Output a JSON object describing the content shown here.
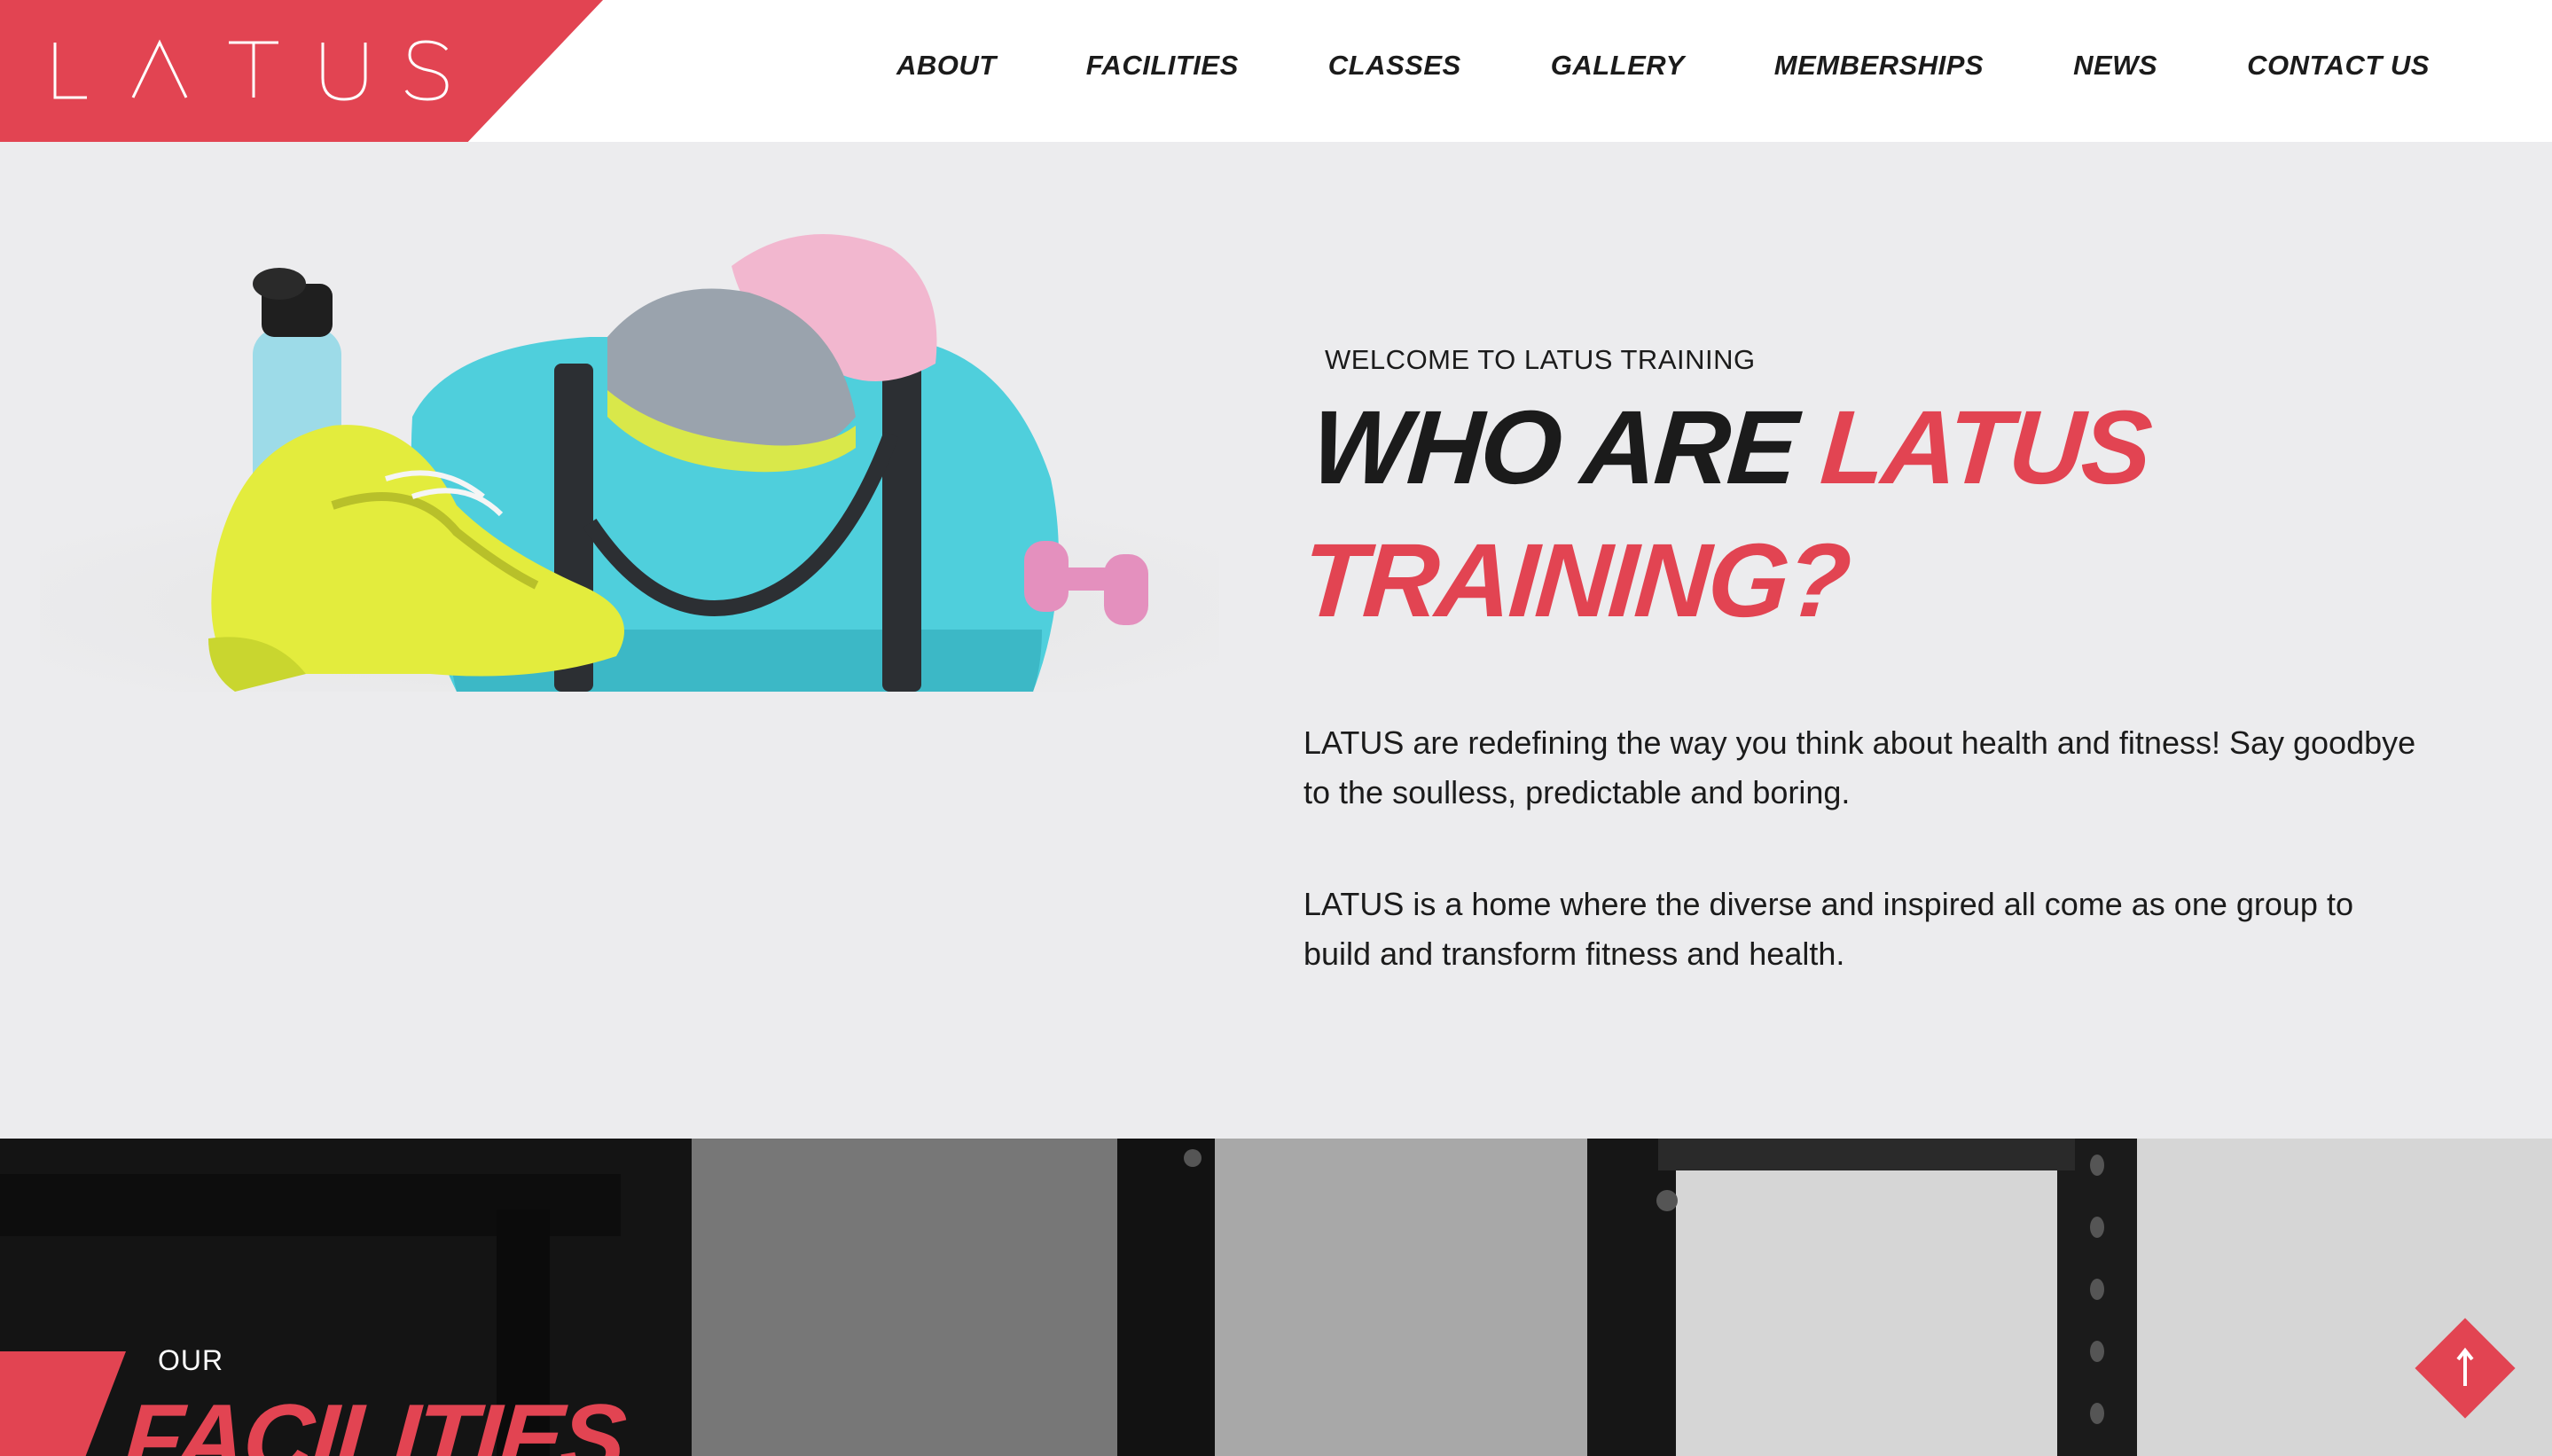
{
  "brand": {
    "logo_text": "LATUS",
    "accent_color": "#e24452"
  },
  "nav": {
    "items": [
      {
        "label": "ABOUT"
      },
      {
        "label": "FACILITIES"
      },
      {
        "label": "CLASSES"
      },
      {
        "label": "GALLERY"
      },
      {
        "label": "MEMBERSHIPS"
      },
      {
        "label": "NEWS"
      },
      {
        "label": "CONTACT US"
      }
    ]
  },
  "intro": {
    "eyebrow": "WELCOME TO LATUS TRAINING",
    "headline_dark": "WHO ARE ",
    "headline_red_1": "LATUS",
    "headline_red_2": "TRAINING?",
    "paragraph_1": "LATUS are redefining the way you think about health and fitness! Say goodbye to the soulless, predictable and boring.",
    "paragraph_2": "LATUS is a home where the diverse and inspired all come as one group to build and transform fitness and health."
  },
  "facilities": {
    "eyebrow": "OUR",
    "title": "FACILITIES"
  },
  "icons": {
    "back_to_top": "arrow-up-icon"
  }
}
